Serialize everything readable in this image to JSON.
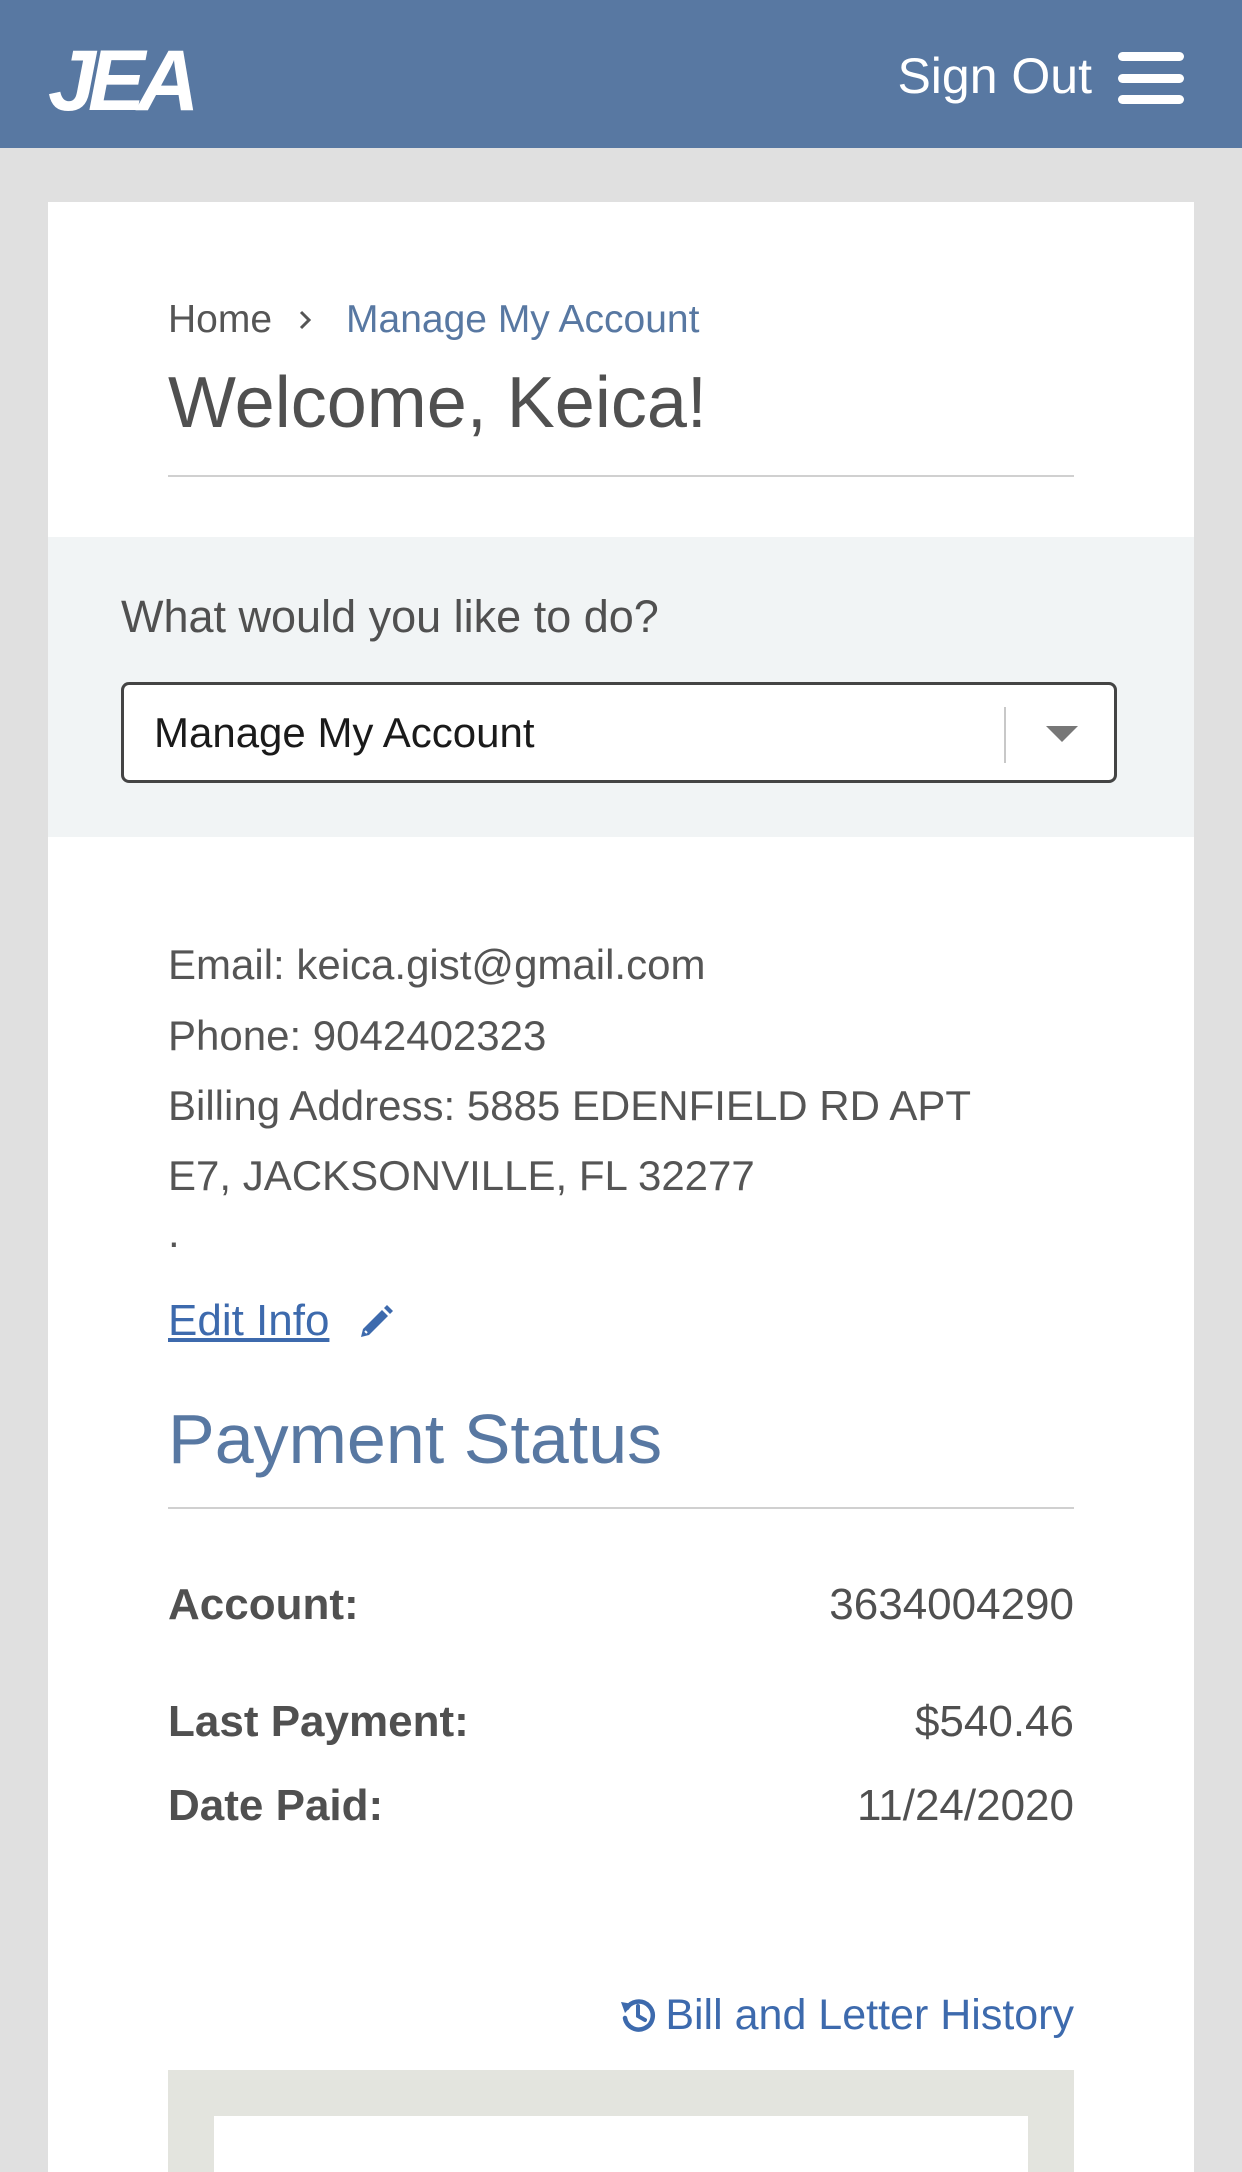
{
  "header": {
    "logo_text": "JEA",
    "sign_out_label": "Sign Out",
    "menu_icon": "hamburger-menu-icon"
  },
  "breadcrumb": {
    "home": "Home",
    "separator_icon": "chevron-right-icon",
    "current": "Manage My Account"
  },
  "page": {
    "title": "Welcome, Keica!"
  },
  "action": {
    "label": "What would you like to do?",
    "selected_value": "Manage My Account",
    "caret_icon": "caret-down-icon"
  },
  "contact": {
    "email": "Email: keica.gist@gmail.com",
    "phone": "Phone: 9042402323",
    "billing_line1": "Billing Address: 5885 EDENFIELD RD APT",
    "billing_line2": "E7, JACKSONVILLE, FL 32277",
    "billing_line3": ".",
    "edit_label": "Edit Info",
    "edit_icon": "pencil-icon"
  },
  "payment_status": {
    "title": "Payment Status",
    "account_label": "Account:",
    "account_value": "3634004290",
    "last_payment_label": "Last Payment:",
    "last_payment_value": "$540.46",
    "date_paid_label": "Date Paid:",
    "date_paid_value": "11/24/2020"
  },
  "history": {
    "label": "Bill and Letter History",
    "icon": "history-icon"
  },
  "colors": {
    "header_bg": "#5878a2",
    "page_bg": "#e0e0e0",
    "link": "#3d6aad",
    "accent_title": "#5878a2",
    "panel_bg": "#f1f4f5"
  }
}
